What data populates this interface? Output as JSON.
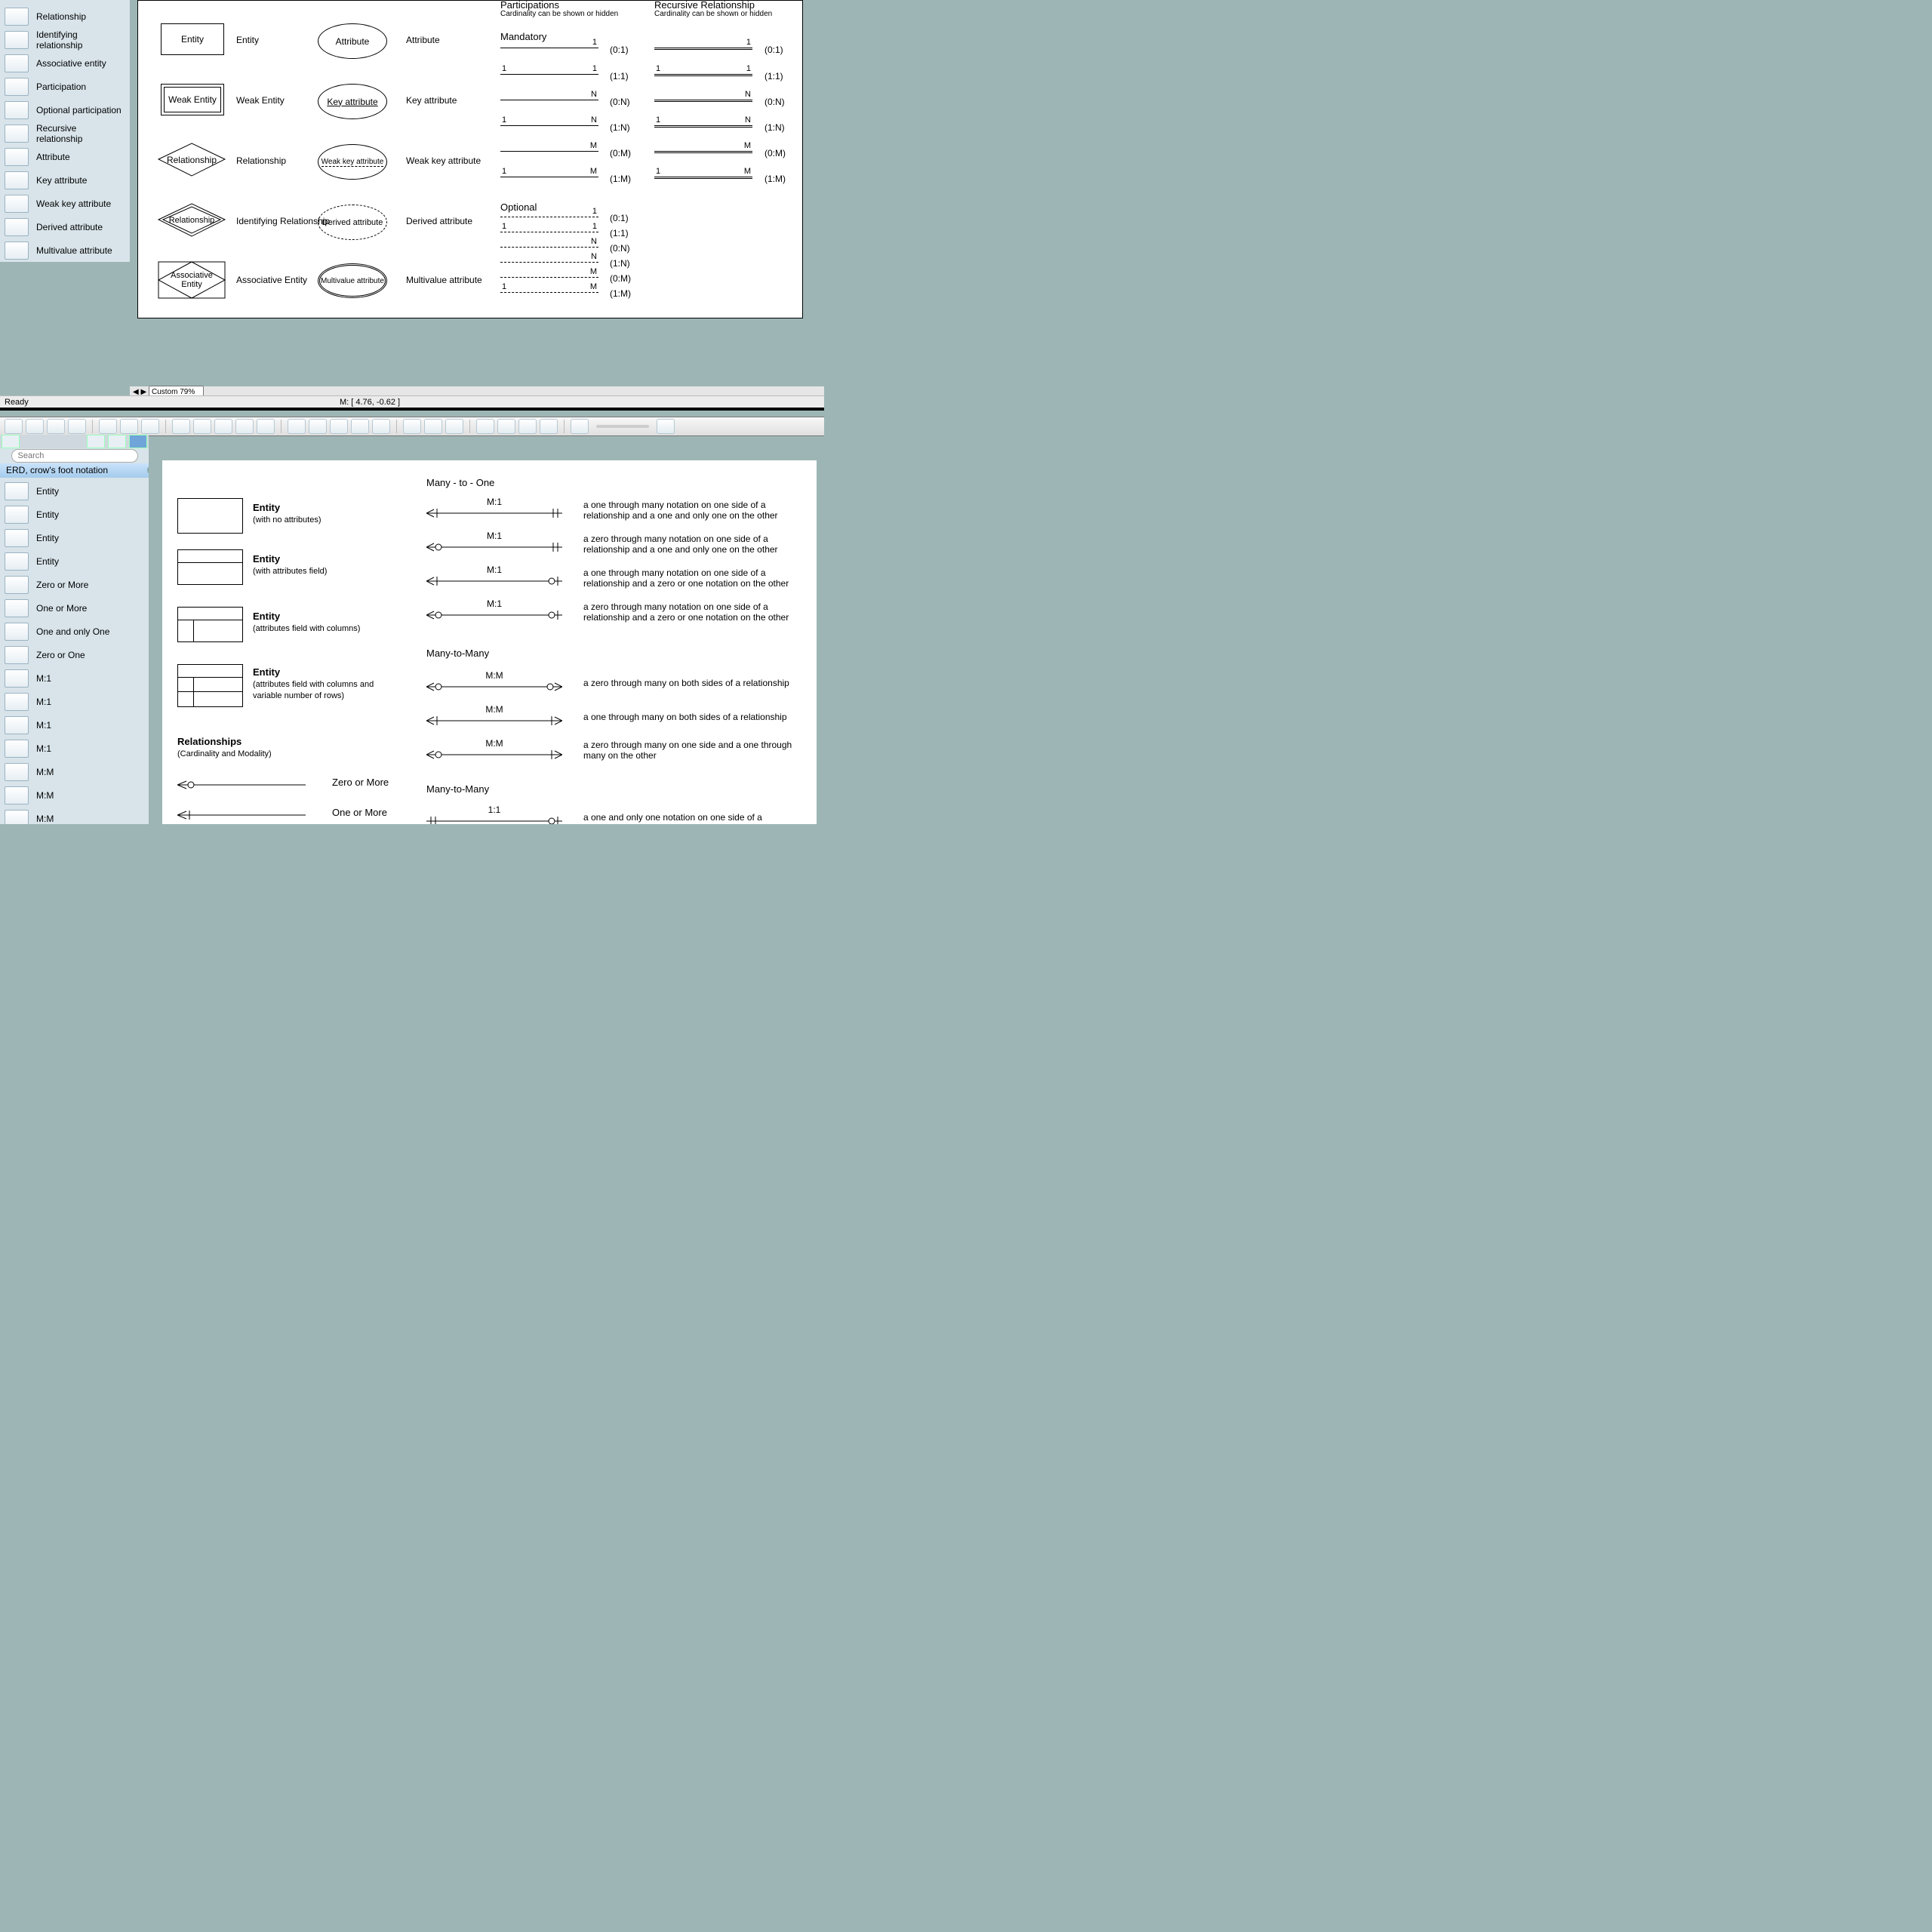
{
  "chen_sidebar": {
    "items": [
      {
        "label": "Relationship"
      },
      {
        "label": "Identifying relationship"
      },
      {
        "label": "Associative entity"
      },
      {
        "label": "Participation"
      },
      {
        "label": "Optional participation"
      },
      {
        "label": "Recursive relationship"
      },
      {
        "label": "Attribute"
      },
      {
        "label": "Key attribute"
      },
      {
        "label": "Weak key attribute"
      },
      {
        "label": "Derived attribute"
      },
      {
        "label": "Multivalue attribute"
      }
    ]
  },
  "chen_page": {
    "entities": [
      {
        "shape": "Entity",
        "label": "Entity"
      },
      {
        "shape": "Weak Entity",
        "label": "Weak Entity"
      },
      {
        "shape": "Relationship",
        "label": "Relationship"
      },
      {
        "shape": "Relationship",
        "label": "Identifying Relationship"
      },
      {
        "shape": "Associative Entity",
        "label": "Associative Entity"
      }
    ],
    "attributes": [
      {
        "shape": "Attribute",
        "label": "Attribute"
      },
      {
        "shape": "Key attribute",
        "label": "Key attribute"
      },
      {
        "shape": "Weak key attribute",
        "label": "Weak key attribute"
      },
      {
        "shape": "Derived attribute",
        "label": "Derived attribute"
      },
      {
        "shape": "Multivalue attribute",
        "label": "Multivalue attribute"
      }
    ],
    "part_header": "Participations",
    "part_sub": "Cardinality can be shown or hidden",
    "rec_header": "Recursive Relationship",
    "rec_sub": "Cardinality can be shown or hidden",
    "mandatory_header": "Mandatory",
    "optional_header": "Optional",
    "m_rows": [
      {
        "l": "",
        "r": "1",
        "c": "(0:1)"
      },
      {
        "l": "1",
        "r": "1",
        "c": "(1:1)"
      },
      {
        "l": "",
        "r": "N",
        "c": "(0:N)"
      },
      {
        "l": "1",
        "r": "N",
        "c": "(1:N)"
      },
      {
        "l": "",
        "r": "M",
        "c": "(0:M)"
      },
      {
        "l": "1",
        "r": "M",
        "c": "(1:M)"
      }
    ],
    "opt_rows": [
      {
        "l": "",
        "r": "1",
        "c": "(0:1)"
      },
      {
        "l": "1",
        "r": "1",
        "c": "(1:1)"
      },
      {
        "l": "",
        "r": "N",
        "c": "(0:N)"
      },
      {
        "l": "",
        "r": "N",
        "c": "(1:N)"
      },
      {
        "l": "",
        "r": "M",
        "c": "(0:M)"
      },
      {
        "l": "1",
        "r": "M",
        "c": "(1:M)"
      }
    ],
    "rec_rows": [
      {
        "c": "(0:1)"
      },
      {
        "c": "(1:1)"
      },
      {
        "c": "(0:N)"
      },
      {
        "c": "(1:N)"
      },
      {
        "c": "(0:M)"
      },
      {
        "c": "(1:M)"
      }
    ]
  },
  "statusbar": {
    "ready": "Ready",
    "zoom": "Custom 79%",
    "m": "M: [ 4.76, -0.62 ]"
  },
  "search": {
    "placeholder": "Search"
  },
  "crow_section": {
    "title": "ERD, crow's foot notation"
  },
  "crow_sidebar": {
    "items": [
      {
        "label": "Entity"
      },
      {
        "label": "Entity"
      },
      {
        "label": "Entity"
      },
      {
        "label": "Entity"
      },
      {
        "label": "Zero or More"
      },
      {
        "label": "One or More"
      },
      {
        "label": "One and only One"
      },
      {
        "label": "Zero or One"
      },
      {
        "label": "M:1"
      },
      {
        "label": "M:1"
      },
      {
        "label": "M:1"
      },
      {
        "label": "M:1"
      },
      {
        "label": "M:M"
      },
      {
        "label": "M:M"
      },
      {
        "label": "M:M"
      }
    ]
  },
  "crow_page": {
    "entities": [
      {
        "title": "Entity",
        "sub": "(with no attributes)"
      },
      {
        "title": "Entity",
        "sub": "(with attributes field)"
      },
      {
        "title": "Entity",
        "sub": "(attributes field with columns)"
      },
      {
        "title": "Entity",
        "sub": "(attributes field with columns and variable number of rows)"
      }
    ],
    "rel_header": "Relationships",
    "rel_sub": "(Cardinality and Modality)",
    "rel_lines": [
      {
        "label": "Zero or More"
      },
      {
        "label": "One or More"
      }
    ],
    "mto_header": "Many - to - One",
    "mto": [
      {
        "cap": "M:1",
        "desc": "a one through many notation on one side of a relationship and a one and only one on the other"
      },
      {
        "cap": "M:1",
        "desc": "a zero through many notation on one side of a relationship and a one and only one on the other"
      },
      {
        "cap": "M:1",
        "desc": "a one through many notation on one side of a relationship and a zero or one notation on the other"
      },
      {
        "cap": "M:1",
        "desc": "a zero through many notation on one side of a relationship and a zero or one notation on the other"
      }
    ],
    "mtm_header": "Many-to-Many",
    "mtm": [
      {
        "cap": "M:M",
        "desc": "a zero through many on both sides of a relationship"
      },
      {
        "cap": "M:M",
        "desc": "a one through many on both sides of a relationship"
      },
      {
        "cap": "M:M",
        "desc": "a zero through many on one side and a one through many on the other"
      }
    ],
    "mto2_header": "Many-to-Many",
    "oo": [
      {
        "cap": "1:1",
        "desc": "a one and only one notation on one side of a relationship"
      }
    ]
  }
}
